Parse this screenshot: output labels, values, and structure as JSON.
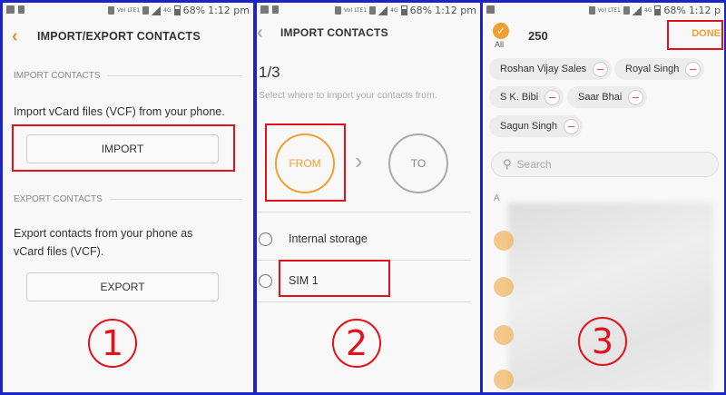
{
  "status_bar": {
    "battery": "68%",
    "time": "1:12 pm",
    "time_partial": "1:12 p",
    "network": "4G",
    "volte": "Vo) LTE1"
  },
  "panel1": {
    "back_icon": "chevron-left-icon",
    "title": "IMPORT/EXPORT CONTACTS",
    "import_section": "IMPORT CONTACTS",
    "import_desc": "Import vCard files (VCF) from your phone.",
    "import_button": "IMPORT",
    "export_section": "EXPORT CONTACTS",
    "export_desc": "Export contacts from your phone as vCard files (VCF).",
    "export_button": "EXPORT",
    "step_badge": "1"
  },
  "panel2": {
    "back_icon": "chevron-left-icon",
    "title": "IMPORT CONTACTS",
    "step": "1/3",
    "desc": "Select where to import your contacts from.",
    "from_label": "FROM",
    "to_label": "TO",
    "options": [
      "Internal storage",
      "SIM 1"
    ],
    "step_badge": "2"
  },
  "panel3": {
    "select_all_label": "All",
    "count": "250",
    "done_label": "DONE",
    "chips": [
      "Roshan Vijay Sales",
      "Royal Singh",
      "S K. Bibi",
      "Saar Bhai",
      "Sagun Singh"
    ],
    "search_placeholder": "Search",
    "index_letter": "A",
    "step_badge": "3"
  },
  "colors": {
    "accent": "#f0a030",
    "highlight": "#e5111a",
    "frame": "#1a24c8"
  }
}
